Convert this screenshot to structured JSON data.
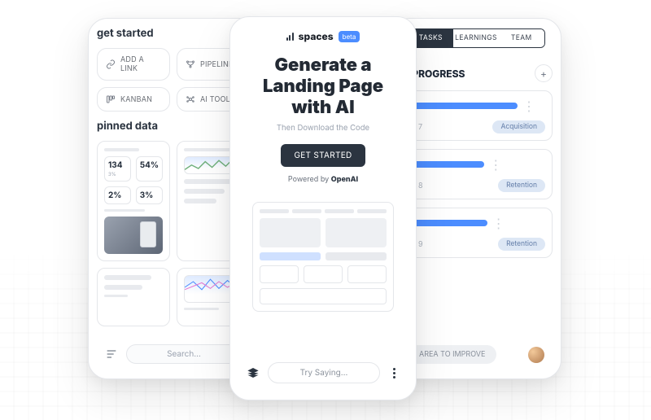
{
  "left": {
    "getStartedTitle": "get started",
    "actions": [
      {
        "icon": "link-icon",
        "label": "ADD A LINK"
      },
      {
        "icon": "pipelines-icon",
        "label": "PIPELINES"
      },
      {
        "icon": "kanban-icon",
        "label": "KANBAN"
      },
      {
        "icon": "ai-tools-icon",
        "label": "AI TOOLS"
      }
    ],
    "pinnedTitle": "pinned data",
    "searchPlaceholder": "Search...",
    "kpis": [
      {
        "value": "134",
        "sub": "3%"
      },
      {
        "value": "54%",
        "sub": ""
      },
      {
        "value": "2%",
        "sub": ""
      },
      {
        "value": "3%",
        "sub": ""
      }
    ]
  },
  "center": {
    "brand": "spaces",
    "badge": "beta",
    "headline_l1": "Generate a",
    "headline_l2": "Landing Page",
    "headline_l3": "with AI",
    "subhead": "Then Download the Code",
    "cta": "GET STARTED",
    "poweredPrefix": "Powered by ",
    "poweredBrand": "OpenAI",
    "tryPlaceholder": "Try Saying..."
  },
  "right": {
    "tabs": [
      "TASKS",
      "LEARNINGS",
      "TEAM"
    ],
    "activeTab": 0,
    "sectionTitle": "IN PROGRESS",
    "tasks": [
      {
        "votes": "7",
        "tag": "Acquisition",
        "barClass": "a"
      },
      {
        "votes": "8",
        "tag": "Retention",
        "barClass": "b"
      },
      {
        "votes": "9",
        "tag": "Retention",
        "barClass": "c"
      }
    ],
    "improve": "AREA TO IMPROVE"
  }
}
